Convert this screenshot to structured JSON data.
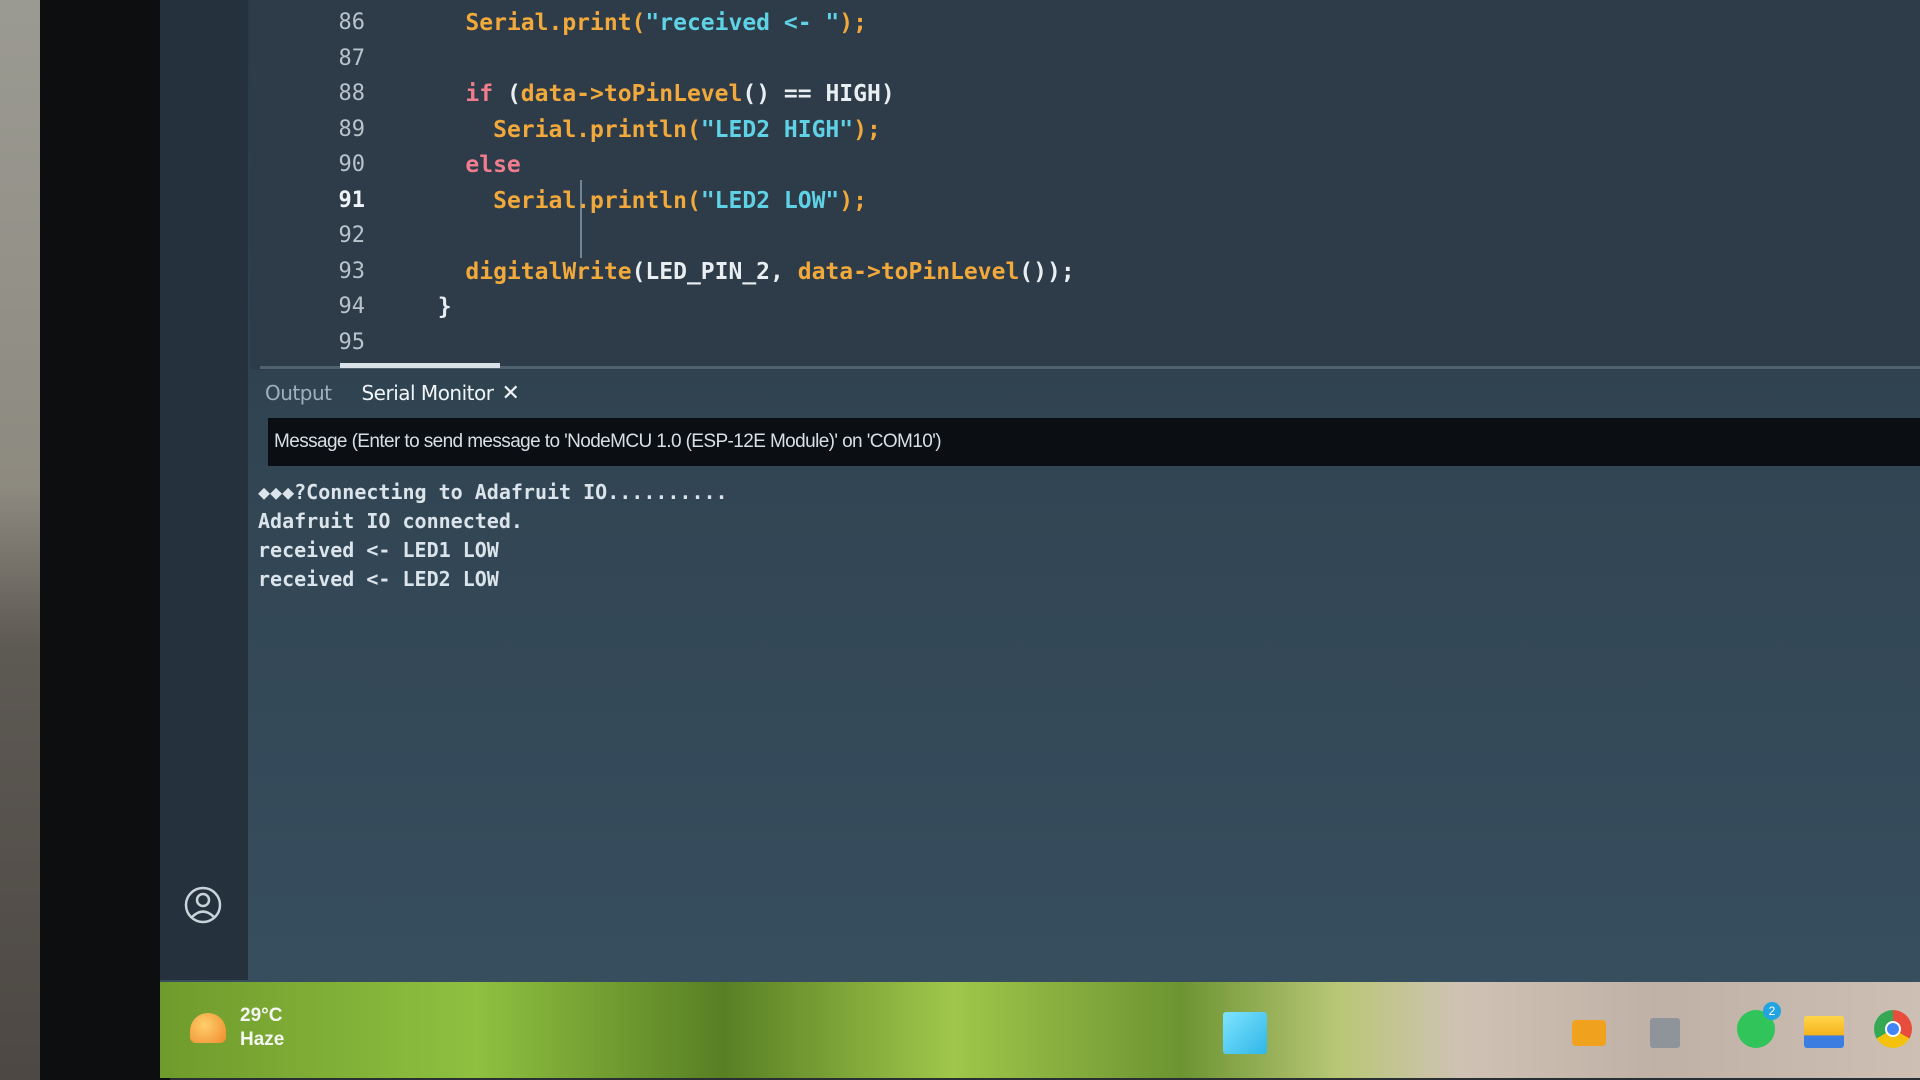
{
  "editor": {
    "lines": [
      {
        "num": "86",
        "segments": [
          {
            "t": "    ",
            "c": "plain"
          },
          {
            "t": "Serial.print(",
            "c": "fn"
          },
          {
            "t": "\"received <- \"",
            "c": "str"
          },
          {
            "t": ");",
            "c": "fn"
          }
        ]
      },
      {
        "num": "87",
        "segments": []
      },
      {
        "num": "88",
        "segments": [
          {
            "t": "    ",
            "c": "plain"
          },
          {
            "t": "if",
            "c": "kw"
          },
          {
            "t": " (",
            "c": "plain"
          },
          {
            "t": "data->toPinLevel",
            "c": "fn"
          },
          {
            "t": "() == HIGH)",
            "c": "plain"
          }
        ]
      },
      {
        "num": "89",
        "segments": [
          {
            "t": "      ",
            "c": "plain"
          },
          {
            "t": "Serial.println(",
            "c": "fn"
          },
          {
            "t": "\"LED2 HIGH\"",
            "c": "str"
          },
          {
            "t": ");",
            "c": "fn"
          }
        ]
      },
      {
        "num": "90",
        "segments": [
          {
            "t": "    ",
            "c": "plain"
          },
          {
            "t": "else",
            "c": "kw"
          }
        ]
      },
      {
        "num": "91",
        "segments": [
          {
            "t": "      ",
            "c": "plain"
          },
          {
            "t": "Serial.println(",
            "c": "fn"
          },
          {
            "t": "\"LED2 LOW\"",
            "c": "str"
          },
          {
            "t": ");",
            "c": "fn"
          }
        ]
      },
      {
        "num": "92",
        "segments": []
      },
      {
        "num": "93",
        "segments": [
          {
            "t": "    ",
            "c": "plain"
          },
          {
            "t": "digitalWrite",
            "c": "fn"
          },
          {
            "t": "(LED_PIN_2, ",
            "c": "plain"
          },
          {
            "t": "data->toPinLevel",
            "c": "fn"
          },
          {
            "t": "());",
            "c": "plain"
          }
        ]
      },
      {
        "num": "94",
        "segments": [
          {
            "t": "  }",
            "c": "plain"
          }
        ]
      },
      {
        "num": "95",
        "segments": []
      }
    ],
    "current_line": "91"
  },
  "panel": {
    "tabs": {
      "output": "Output",
      "serial_monitor": "Serial Monitor",
      "close_symbol": "✕"
    },
    "message_placeholder": "Message (Enter to send message to 'NodeMCU 1.0 (ESP-12E Module)' on 'COM10')",
    "serial_lines": [
      "◆◆◆?Connecting to Adafruit IO..........",
      "Adafruit IO connected.",
      "received <- LED1 LOW",
      "received <- LED2 LOW"
    ]
  },
  "taskbar": {
    "weather": {
      "temp": "29°C",
      "condition": "Haze"
    },
    "whatsapp_badge": "2"
  },
  "colors": {
    "function": "#f2a93b",
    "string": "#5fd2e6",
    "keyword": "#f07d8e",
    "plain": "#e9eef2"
  }
}
